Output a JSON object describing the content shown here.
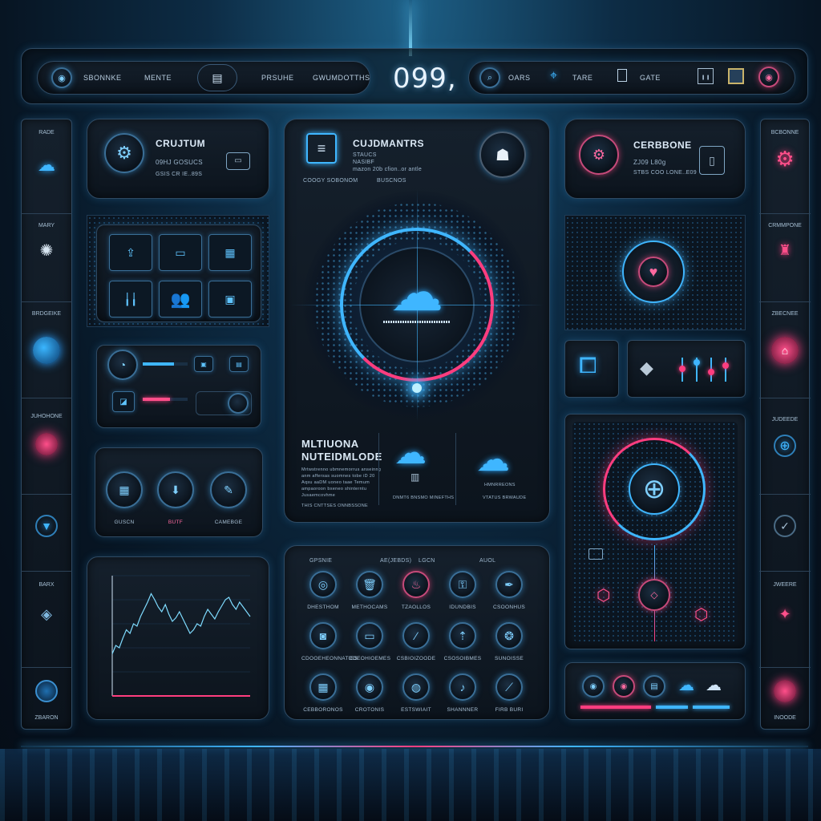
{
  "topbar": {
    "left_items": [
      {
        "label": "SBONNKE",
        "icon": "eye-icon"
      },
      {
        "label": "MENTE",
        "icon": null
      },
      {
        "label": "PRSUHE",
        "icon": "server-icon"
      },
      {
        "label": "GWUMDOTTHS",
        "icon": null
      }
    ],
    "center_readout": "099,",
    "right_items": [
      {
        "label": "OARS",
        "icon": "search-icon"
      },
      {
        "label": "TARE",
        "icon": "location-pin-icon"
      },
      {
        "label": "GATE",
        "icon": "document-icon"
      }
    ]
  },
  "left_sidebar": {
    "items": [
      {
        "label": "RADE",
        "icon": "cloud-icon"
      },
      {
        "label": "MARY",
        "icon": "network-icon"
      },
      {
        "label": "BRDGEIKE",
        "icon": "orb-icon"
      },
      {
        "label": "JUHOHONE",
        "icon": "stack-icon"
      },
      {
        "label": "",
        "icon": "shield-icon"
      },
      {
        "label": "BARX",
        "icon": "cube-icon"
      },
      {
        "label": "ZBARON",
        "icon": "gauge-icon"
      }
    ]
  },
  "right_sidebar": {
    "items": [
      {
        "label": "BCBONNE",
        "icon": "gear-icon"
      },
      {
        "label": "CRMMPONE",
        "icon": "robot-icon"
      },
      {
        "label": "ZBECNEE",
        "icon": "home-icon"
      },
      {
        "label": "JUDEEDE",
        "icon": "globe-icon"
      },
      {
        "label": "",
        "icon": "check-shield-icon"
      },
      {
        "label": "JWEERE",
        "icon": "crystal-icon"
      },
      {
        "label": "INOODE",
        "icon": "power-icon"
      }
    ]
  },
  "card_crujtum": {
    "title": "CRUJTUM",
    "line1": "09HJ Gosucs",
    "line2": "GSIS  CR IE..89S"
  },
  "card_cerbbone": {
    "title": "CERBBONE",
    "line1": "ZJ09 L80g",
    "line2": "STBS  COO lONE..E09"
  },
  "center_card": {
    "title": "CUJDMANTRS",
    "sub1": "STAUCS",
    "sub2": "NASIBF",
    "sub3": "mazon 20b  cfion..or antle",
    "sub4": "COOGY  SOBONOM",
    "sub5": "BUSCNOS",
    "bottom_title_1": "MLTIUONA",
    "bottom_title_2": "NUTEIDMLODE",
    "bottom_body": [
      "Mrtwstrenno ubmnemorrus anseinng",
      "anm  affersas suomnes tobe iD 20",
      "Aqsu aaDM uoneo taae Temum",
      "ampaoroon bxeneo shinterntu",
      "Jusaemcovhme"
    ],
    "bottom_footer": "THIS CNTTSES ONNBSSONE",
    "cloud_left_caption": "DNMT6 BNSMO MINEFTHS",
    "cloud_right_caption_1": "HMNRREONS",
    "cloud_right_caption_2": "VTATUS BRWAUDE"
  },
  "controls_card": {
    "labels": [
      "GUSCN",
      "BUTF",
      "CAMEBGE"
    ]
  },
  "icon_grid": {
    "header": [
      "GPSNIE",
      "AE(JEBDS)",
      "LGCN",
      "AUOL"
    ],
    "rows": [
      [
        "DHESTHOM",
        "METHOCAMS",
        "TZAOLLOS",
        "IDUNDBIS",
        "CSOONHUS"
      ],
      [
        "CDOOEHEONNATIES",
        "COEOHIOEMES",
        "CSBIOIZOODE",
        "CSOSOIBMES",
        "SUNOISSE"
      ],
      [
        "CEBBORONOS",
        "CROTONIS",
        "ESTSWIAIT",
        "SHANNNER",
        "FIRB BURI"
      ]
    ]
  },
  "chart": {
    "type": "area",
    "color": "#36b6ff"
  },
  "chart_data": {
    "type": "area",
    "x": [
      0,
      1,
      2,
      3,
      4,
      5,
      6,
      7,
      8,
      9,
      10,
      11,
      12,
      13,
      14,
      15,
      16,
      17,
      18,
      19,
      20,
      21,
      22,
      23,
      24,
      25,
      26,
      27,
      28,
      29,
      30,
      31,
      32,
      33,
      34,
      35,
      36,
      37,
      38,
      39
    ],
    "values": [
      35,
      42,
      40,
      48,
      55,
      52,
      60,
      58,
      66,
      72,
      78,
      85,
      80,
      74,
      70,
      76,
      68,
      62,
      65,
      70,
      64,
      58,
      52,
      55,
      60,
      58,
      66,
      72,
      68,
      64,
      70,
      75,
      80,
      82,
      76,
      72,
      78,
      74,
      70,
      66
    ],
    "title": "",
    "xlabel": "",
    "ylabel": "",
    "ylim": [
      0,
      100
    ]
  },
  "colors": {
    "accent_blue": "#36b6ff",
    "accent_pink": "#ff3d7f",
    "panel_border": "#2f4a63"
  }
}
